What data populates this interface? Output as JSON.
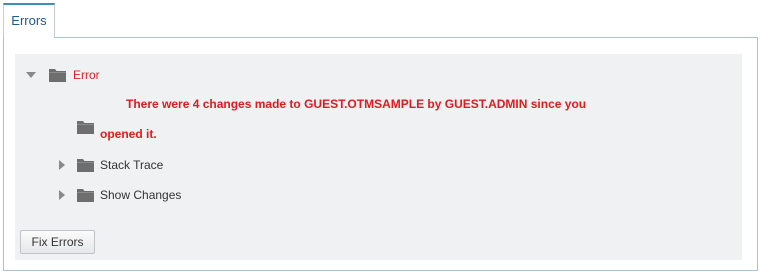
{
  "tabs": [
    {
      "label": "Errors",
      "active": true
    }
  ],
  "tree": {
    "root": {
      "label": "Error",
      "expanded": true,
      "icon": "folder-icon"
    },
    "message_line1": "There were 4 changes made to GUEST.OTMSAMPLE by GUEST.ADMIN since you",
    "message_line2": "opened it.",
    "children": [
      {
        "label": "Stack Trace",
        "expanded": false,
        "icon": "folder-icon"
      },
      {
        "label": "Show Changes",
        "expanded": false,
        "icon": "folder-icon"
      }
    ]
  },
  "buttons": {
    "fix_errors": "Fix Errors"
  },
  "colors": {
    "error_text": "#e01b1b",
    "tab_accent": "#3c8dbc",
    "panel_bg": "#f0f1f3"
  }
}
